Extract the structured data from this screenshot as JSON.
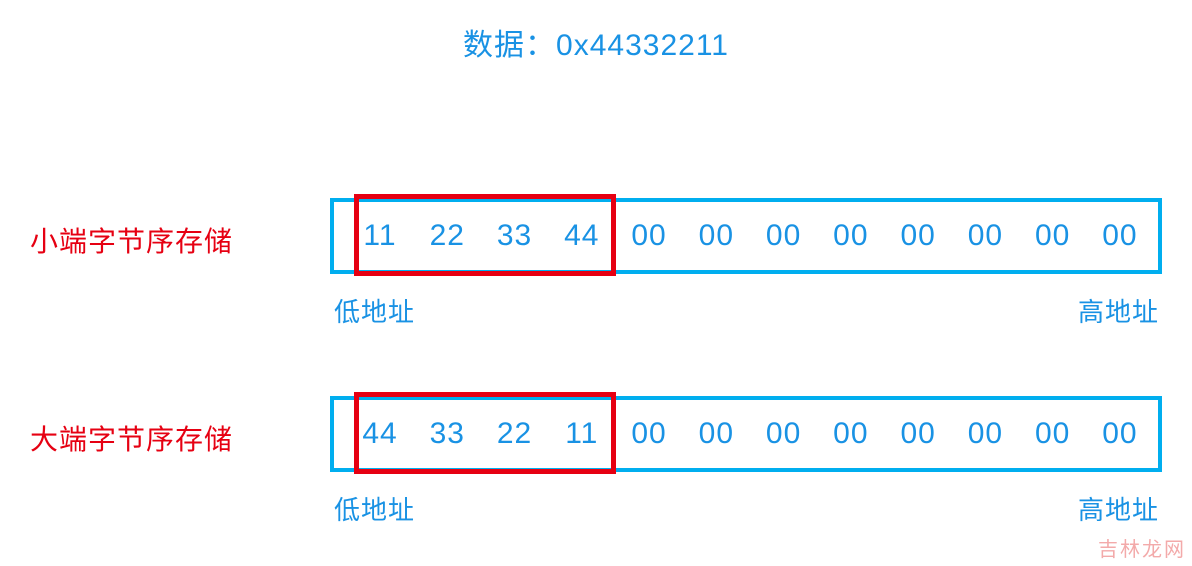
{
  "title": "数据：0x44332211",
  "rows": [
    {
      "label": "小端字节序存储",
      "bytes": [
        "11",
        "22",
        "33",
        "44",
        "00",
        "00",
        "00",
        "00",
        "00",
        "00",
        "00",
        "00"
      ],
      "low_addr": "低地址",
      "high_addr": "高地址"
    },
    {
      "label": "大端字节序存储",
      "bytes": [
        "44",
        "33",
        "22",
        "11",
        "00",
        "00",
        "00",
        "00",
        "00",
        "00",
        "00",
        "00"
      ],
      "low_addr": "低地址",
      "high_addr": "高地址"
    }
  ],
  "watermark": "吉林龙网",
  "colors": {
    "blue_text": "#1992e4",
    "blue_border": "#00aeef",
    "red": "#e60012",
    "watermark": "#f2a1a1"
  }
}
